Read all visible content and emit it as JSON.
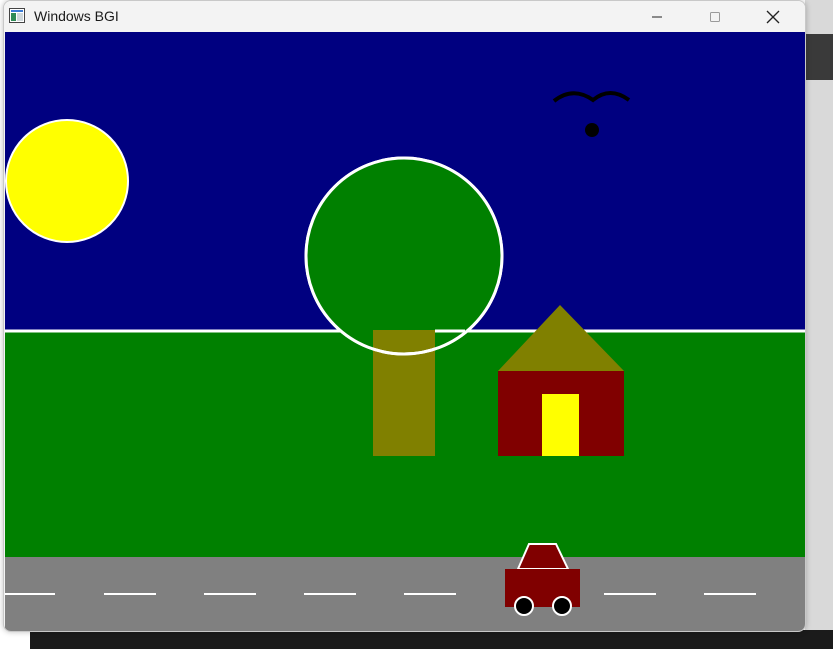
{
  "window": {
    "title": "Windows BGI",
    "icon": "window-app-icon",
    "controls": [
      "minimize-icon",
      "maximize-icon",
      "close-icon"
    ]
  },
  "scene": {
    "colors": {
      "sky": "#000080",
      "grass": "#008000",
      "sun": "#ffff00",
      "tree_crown": "#008000",
      "trunk": "#808000",
      "roof": "#808000",
      "house": "#800000",
      "door": "#ffff00",
      "road": "#808080",
      "car": "#800000",
      "outline": "#ffffff",
      "bird": "#000000"
    },
    "elements": [
      "sun",
      "bird",
      "horizon",
      "tree",
      "house",
      "road",
      "car"
    ]
  }
}
